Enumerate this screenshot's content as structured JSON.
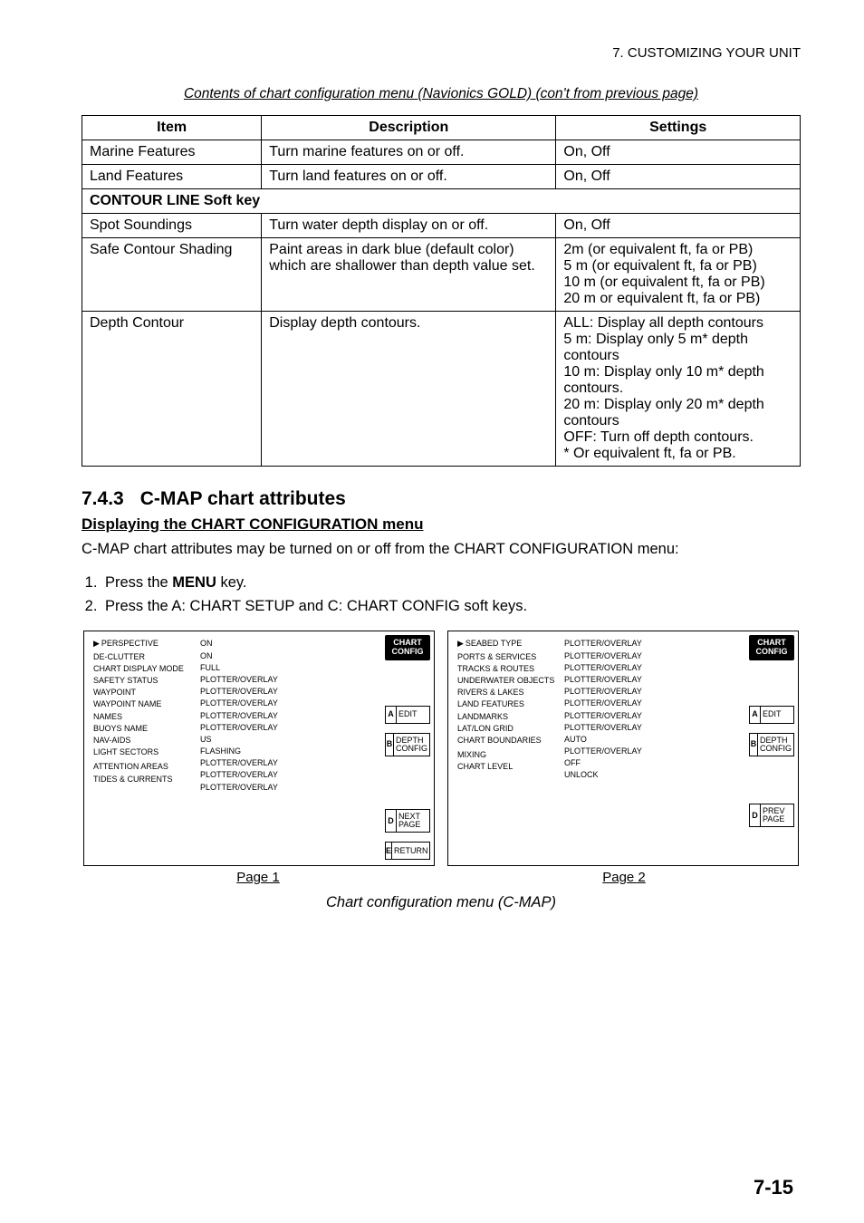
{
  "header_right": "7. CUSTOMIZING YOUR UNIT",
  "subtitle": "Contents of chart configuration menu (Navionics GOLD) (con't from previous page)",
  "table": {
    "headers": {
      "item": "Item",
      "desc": "Description",
      "settings": "Settings"
    },
    "rows": [
      {
        "item": "Marine Features",
        "desc": "Turn marine features on or off.",
        "settings": "On, Off"
      },
      {
        "item": "Land Features",
        "desc": "Turn land features on or off.",
        "settings": "On, Off"
      }
    ],
    "section": "CONTOUR LINE Soft key",
    "rows2": [
      {
        "item": "Spot Soundings",
        "desc": "Turn water depth display on or off.",
        "settings": "On, Off"
      },
      {
        "item": "Safe Contour Shading",
        "desc": "Paint areas in dark blue (default color) which are shallower than depth value set.",
        "settings": "2m (or equivalent ft, fa or PB)\n5 m (or equivalent ft, fa or PB)\n10 m (or equivalent ft, fa or PB)\n20 m or equivalent ft, fa or PB)"
      },
      {
        "item": "Depth Contour",
        "desc": "Display depth contours.",
        "settings": "ALL: Display all depth contours\n5 m: Display only 5 m* depth contours\n10 m: Display only 10 m* depth contours.\n20 m: Display only 20 m* depth contours\nOFF: Turn off depth contours.\n* Or equivalent ft, fa or PB."
      }
    ]
  },
  "sec": {
    "num": "7.4.3",
    "title": "C-MAP chart attributes"
  },
  "subhead": "Displaying the CHART CONFIGURATION menu",
  "para": "C-MAP chart attributes may be turned on or off from the CHART CONFIGURATION menu:",
  "steps": [
    "Press the MENU key.",
    "Press the A: CHART SETUP and C: CHART CONFIG soft keys."
  ],
  "panel_tab": "CHART CONFIG",
  "softkeys": {
    "a": "EDIT",
    "b1": "DEPTH",
    "b2": "CONFIG",
    "d1_p1": "NEXT",
    "d2_p1": "PAGE",
    "d1_p2": "PREV",
    "d2_p2": "PAGE",
    "e": "RETURN"
  },
  "panel1": {
    "left": [
      "PERSPECTIVE",
      "DE-CLUTTER",
      "CHART DISPLAY MODE",
      "SAFETY STATUS",
      "WAYPOINT",
      "WAYPOINT NAME",
      "NAMES",
      "BUOYS NAME",
      "NAV-AIDS",
      "LIGHT SECTORS",
      "",
      "ATTENTION AREAS",
      "TIDES & CURRENTS"
    ],
    "right": [
      "ON",
      "ON",
      "FULL",
      "PLOTTER/OVERLAY",
      "PLOTTER/OVERLAY",
      "PLOTTER/OVERLAY",
      "PLOTTER/OVERLAY",
      "PLOTTER/OVERLAY",
      "US",
      "FLASHING",
      "PLOTTER/OVERLAY",
      "PLOTTER/OVERLAY",
      "PLOTTER/OVERLAY"
    ]
  },
  "panel2": {
    "left": [
      "SEABED TYPE",
      "PORTS & SERVICES",
      "TRACKS & ROUTES",
      "UNDERWATER OBJECTS",
      "RIVERS & LAKES",
      "LAND FEATURES",
      "LANDMARKS",
      "LAT/LON GRID",
      "CHART BOUNDARIES",
      "",
      "MIXING",
      "CHART LEVEL"
    ],
    "right": [
      "PLOTTER/OVERLAY",
      "PLOTTER/OVERLAY",
      "PLOTTER/OVERLAY",
      "PLOTTER/OVERLAY",
      "PLOTTER/OVERLAY",
      "PLOTTER/OVERLAY",
      "PLOTTER/OVERLAY",
      "PLOTTER/OVERLAY",
      "AUTO",
      "PLOTTER/OVERLAY",
      "OFF",
      "UNLOCK"
    ]
  },
  "page_labels": {
    "p1": "Page 1",
    "p2": "Page 2"
  },
  "fig_caption": "Chart configuration menu (C-MAP)",
  "page_num": "7-15"
}
